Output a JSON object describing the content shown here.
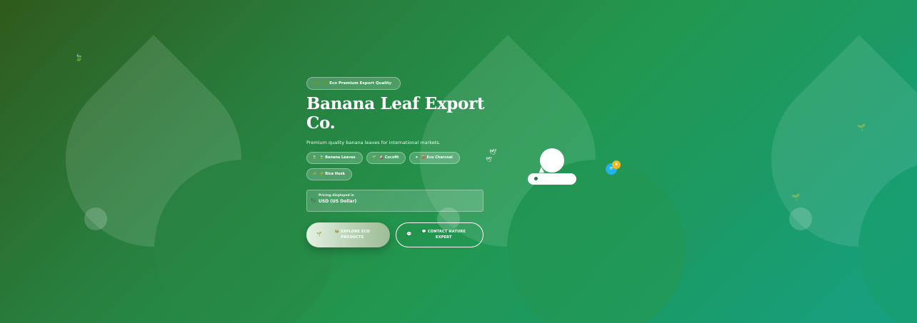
{
  "hero": {
    "badge": {
      "icon": "🌿",
      "label": "🌿 Eco Premium Export Quality"
    },
    "title": "Banana Leaf Export Co.",
    "subtitle": "Premium quality banana leaves for international markets.",
    "chips": [
      {
        "icon": "🍃",
        "label": "🍃 Banana Leaves"
      },
      {
        "icon": "🌱",
        "label": "🥥 Cocofit"
      },
      {
        "icon": "⚫",
        "label": "🪵 Eco Charcoal"
      },
      {
        "icon": "🌾",
        "label": "🌾 Rice Husk"
      }
    ],
    "currency": {
      "icon": "💱",
      "label": "Pricing displayed in",
      "value": "USD (US Dollar)"
    },
    "buttons": {
      "explore": {
        "icon": "🌱",
        "label": "🐝 EXPLORE ECO PRODUCTS"
      },
      "contact": {
        "icon": "💬",
        "label": "💬 CONTACT NATURE EXPERT"
      }
    }
  },
  "decor": {
    "leaf_icon": "🍃",
    "sprout_icon": "🌱",
    "bird_icon": "🕊"
  },
  "chat_widget": {
    "status_blue_icon": "⟳",
    "status_gold_icon": "★"
  }
}
